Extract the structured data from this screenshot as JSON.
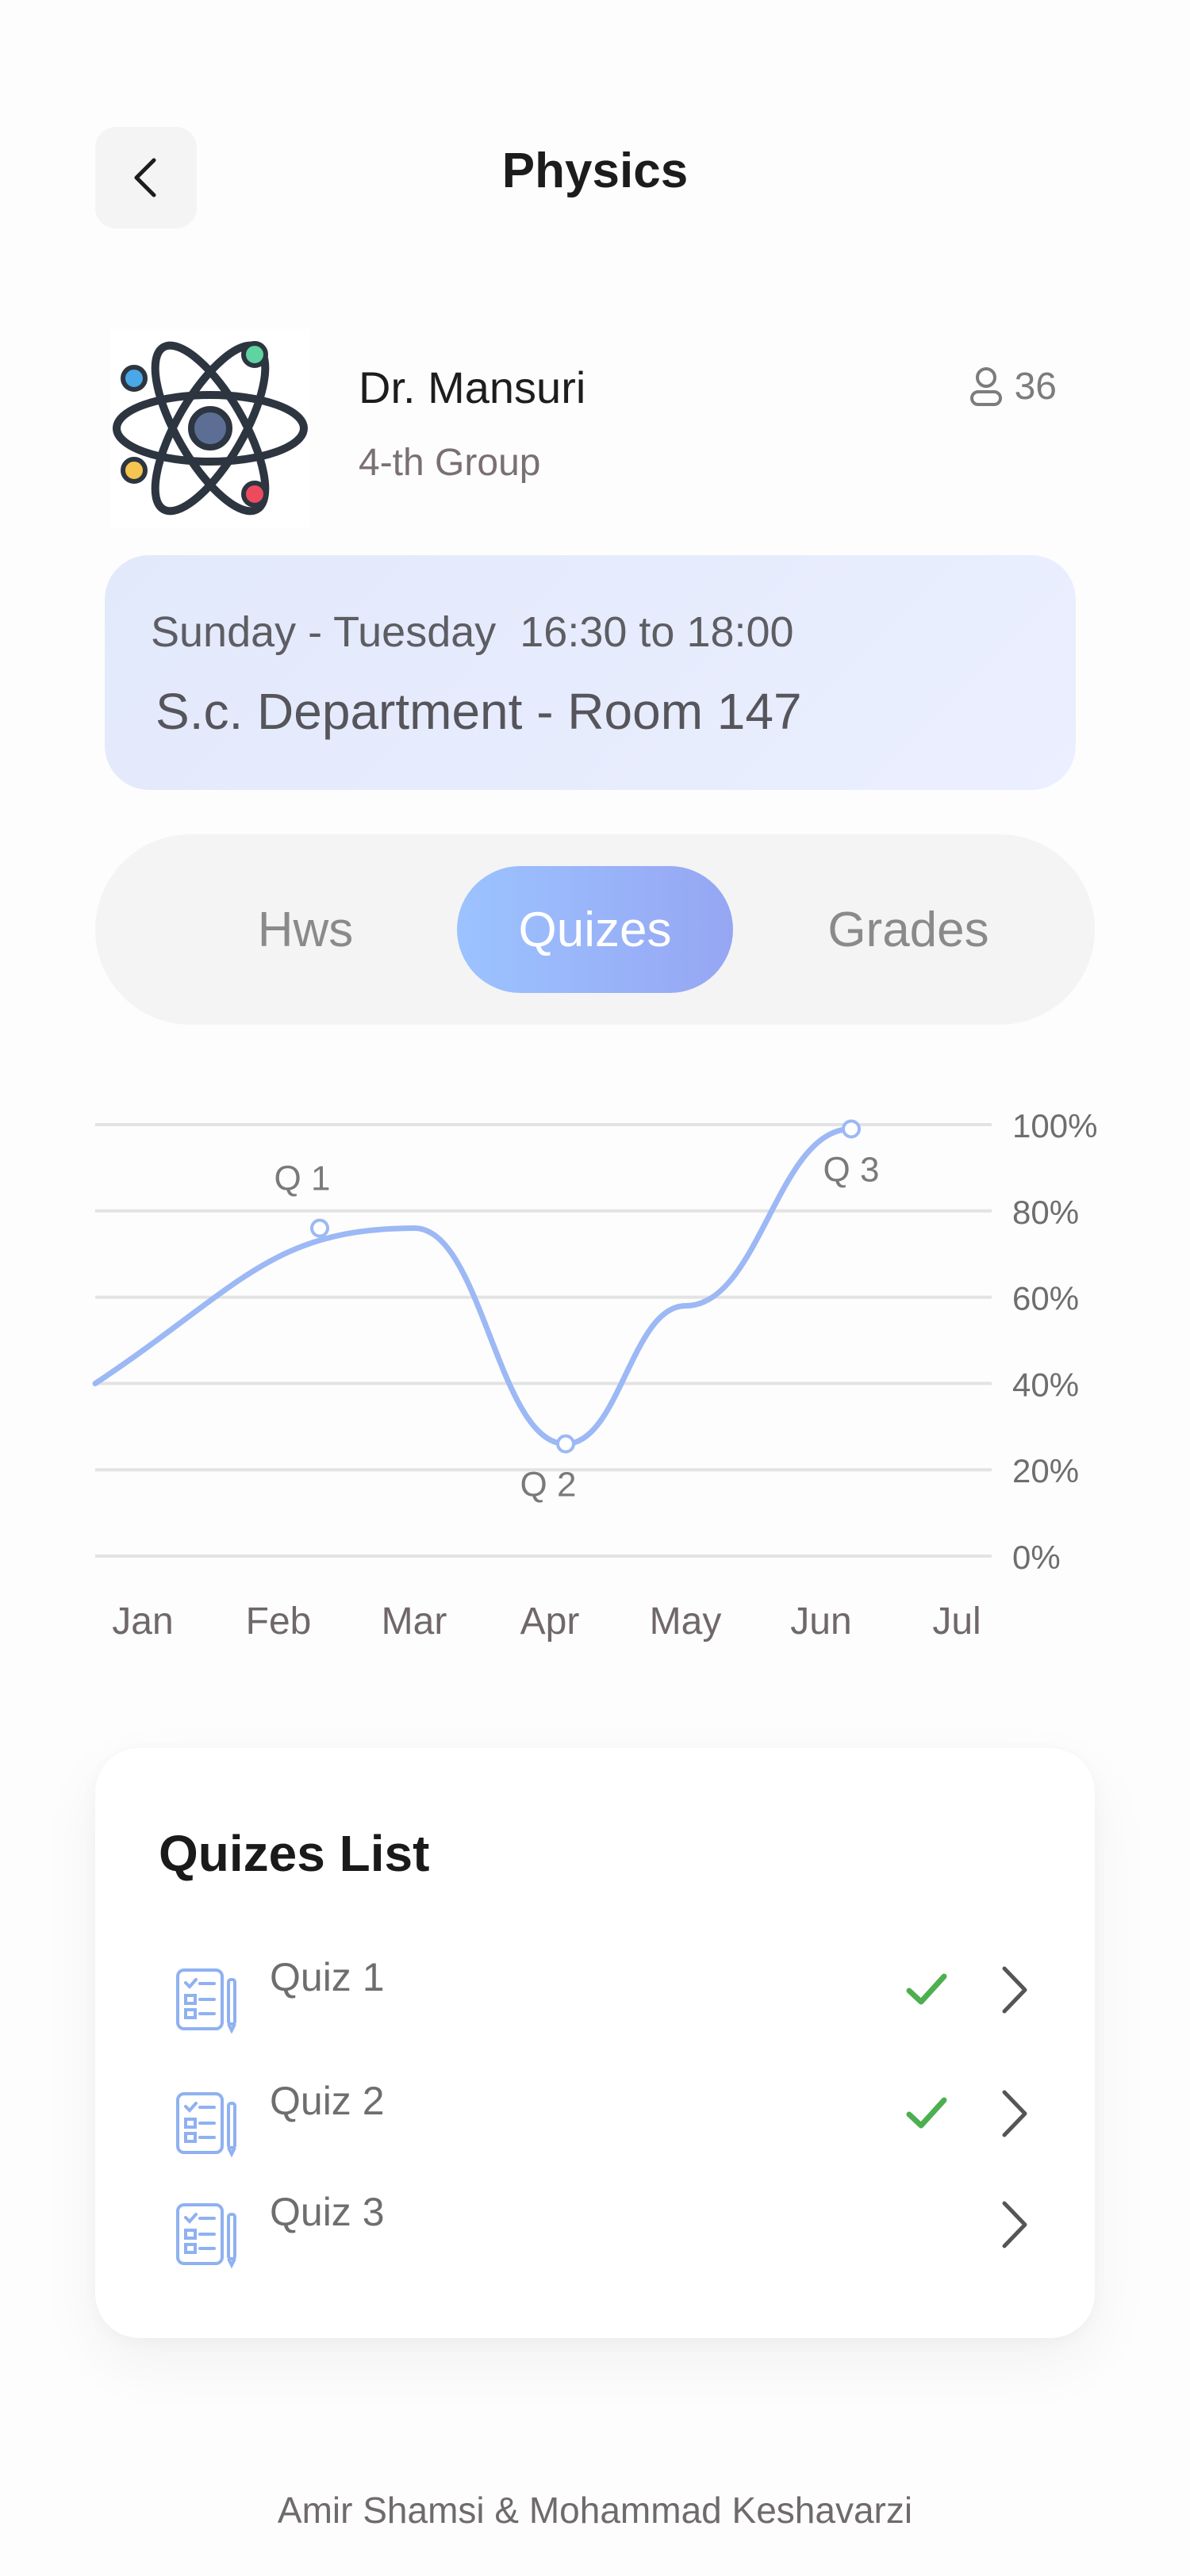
{
  "header": {
    "title": "Physics",
    "back_icon": "chevron-left-icon"
  },
  "teacher": {
    "name": "Dr. Mansuri",
    "group": "4-th Group",
    "student_count": "36",
    "avatar_icon": "atom-icon",
    "student_icon": "user-icon"
  },
  "schedule": {
    "time": "Sunday - Tuesday  16:30 to 18:00",
    "room": "S.c. Department - Room 147"
  },
  "tabs": [
    {
      "label": "Hws",
      "active": false
    },
    {
      "label": "Quizes",
      "active": true
    },
    {
      "label": "Grades",
      "active": false
    }
  ],
  "chart_data": {
    "type": "line",
    "x": [
      "Jan",
      "Feb",
      "Mar",
      "Apr",
      "May",
      "Jun",
      "Jul"
    ],
    "ylim": [
      0,
      100
    ],
    "y_ticks": [
      "0%",
      "20%",
      "40%",
      "60%",
      "80%",
      "100%"
    ],
    "series": [
      {
        "values": [
          40,
          null,
          76,
          26,
          58,
          99,
          null
        ]
      }
    ],
    "markers": [
      {
        "label": "Q 1",
        "x": "Feb",
        "value": 76
      },
      {
        "label": "Q 2",
        "x": "Apr",
        "value": 26
      },
      {
        "label": "Q 3",
        "x": "Jun",
        "value": 99
      }
    ],
    "grid": true,
    "line_color": "#9cb8f5"
  },
  "quiz_list": {
    "title": "Quizes List",
    "items": [
      {
        "label": "Quiz 1",
        "completed": true
      },
      {
        "label": "Quiz 2",
        "completed": true
      },
      {
        "label": "Quiz 3",
        "completed": false
      }
    ],
    "item_icon": "quiz-sheet-icon",
    "check_color": "#4caf50"
  },
  "footer": {
    "credit": "Amir Shamsi & Mohammad Keshavarzi"
  }
}
